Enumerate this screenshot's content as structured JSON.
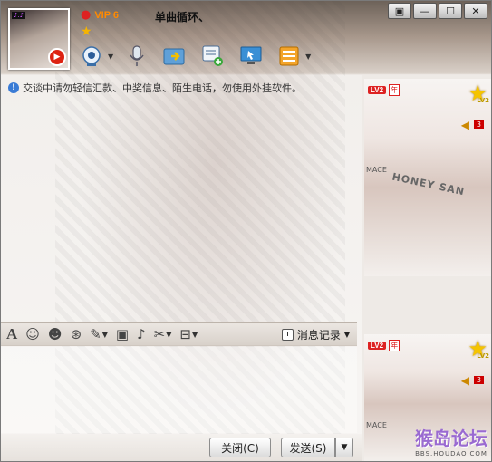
{
  "header": {
    "vip_label": "VIP 6",
    "status_text": "单曲循环、",
    "avatar_tag": "♪.♪"
  },
  "window_controls": [
    "▣",
    "—",
    "☐",
    "✕"
  ],
  "toolbar": {
    "icons": [
      "webcam-icon",
      "microphone-icon",
      "file-transfer-icon",
      "group-chat-icon",
      "remote-assist-icon",
      "app-box-icon"
    ]
  },
  "chat": {
    "notice": "交谈中请勿轻信汇款、中奖信息、陌生电话，勿使用外挂软件。"
  },
  "format_bar": {
    "history_label": "消息记录"
  },
  "buttons": {
    "close_label": "关闭(C)",
    "send_label": "发送(S)",
    "send_arrow": "▼"
  },
  "right_panel": {
    "level_badge": "LV2",
    "year_badge": "年",
    "lv2_small": "LV2",
    "count": "3",
    "photo_brand": "MACE",
    "shirt_text": "HONEY SAN"
  },
  "watermark": {
    "main": "猴岛论坛",
    "sub": "BBS.HOUDAO.COM"
  },
  "colors": {
    "vip": "#ff8a00",
    "badge_red": "#d22",
    "watermark": "#9a6ad1"
  }
}
